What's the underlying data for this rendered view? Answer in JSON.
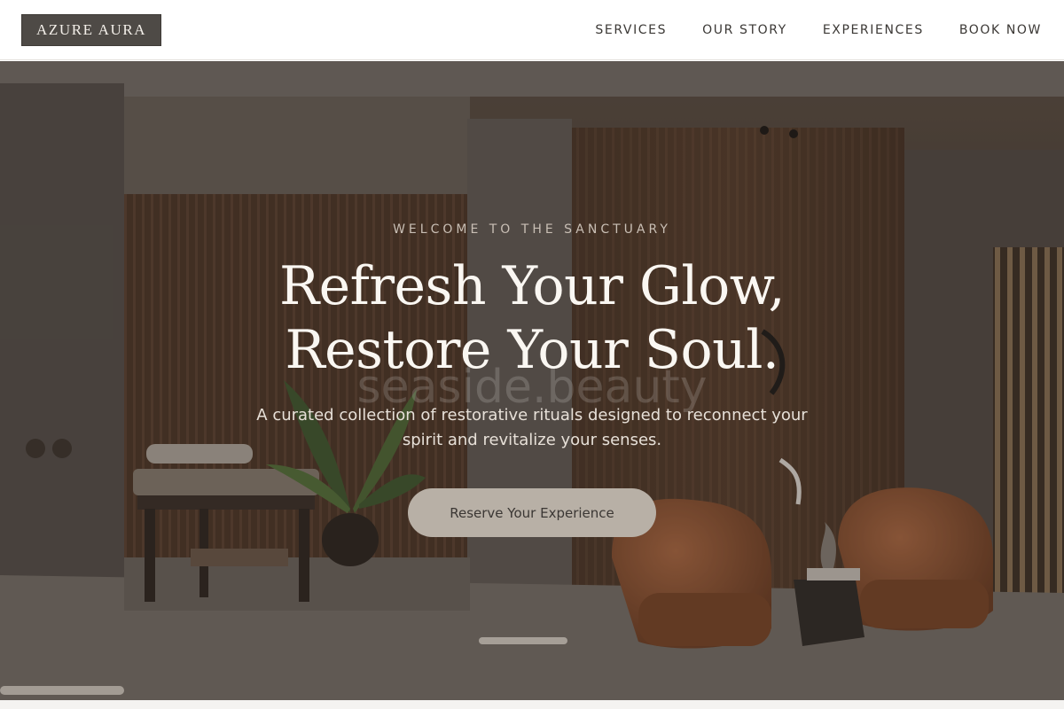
{
  "brand": {
    "name": "AZURE AURA"
  },
  "nav": {
    "items": [
      {
        "label": "SERVICES"
      },
      {
        "label": "OUR STORY"
      },
      {
        "label": "EXPERIENCES"
      },
      {
        "label": "BOOK NOW"
      }
    ]
  },
  "hero": {
    "eyebrow": "WELCOME TO THE SANCTUARY",
    "headline_line1": "Refresh Your Glow,",
    "headline_line2": "Restore Your Soul.",
    "watermark": "seaside.beauty",
    "subtext": "A curated collection of restorative rituals designed to reconnect your spirit and revitalize your senses.",
    "cta_label": "Reserve Your Experience"
  },
  "colors": {
    "logo_bg": "#4e4a46",
    "cta_bg": "#b8b0a6",
    "headline": "#faf7f2",
    "eyebrow": "#c9bfb5"
  }
}
